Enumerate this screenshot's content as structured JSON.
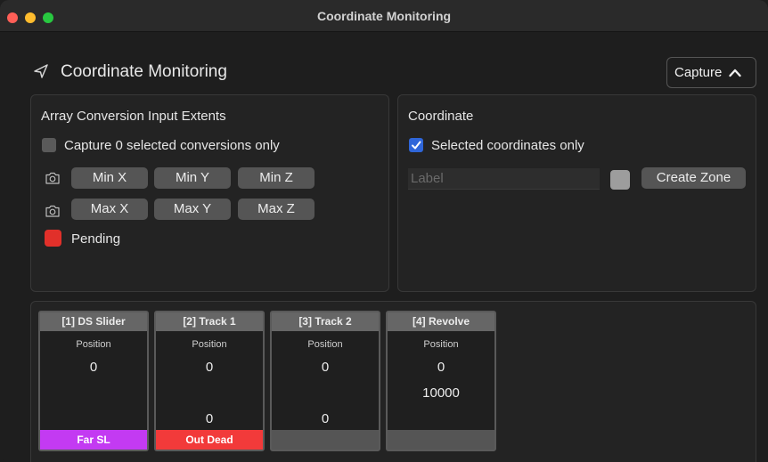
{
  "window": {
    "title": "Coordinate Monitoring"
  },
  "header": {
    "title": "Coordinate Monitoring",
    "icon": "navigation-arrow-icon",
    "capture_label": "Capture"
  },
  "extents": {
    "title": "Array Conversion Input Extents",
    "checkbox_label": "Capture 0 selected conversions only",
    "checkbox_checked": false,
    "min_buttons": [
      "Min X",
      "Min Y",
      "Min Z"
    ],
    "max_buttons": [
      "Max X",
      "Max Y",
      "Max Z"
    ],
    "status_label": "Pending",
    "status_color": "#e1302a"
  },
  "coordinate": {
    "title": "Coordinate",
    "checkbox_label": "Selected coordinates only",
    "checkbox_checked": true,
    "label_placeholder": "Label",
    "label_value": "",
    "create_zone_label": "Create Zone",
    "swatch_color": "#9d9d9d"
  },
  "cards": [
    {
      "name": "[1] DS Slider",
      "subtitle": "Position",
      "values": [
        "0",
        "",
        ""
      ],
      "footer": "Far SL",
      "footer_color": "#c33af2"
    },
    {
      "name": "[2] Track 1",
      "subtitle": "Position",
      "values": [
        "0",
        "",
        "0"
      ],
      "footer": "Out Dead",
      "footer_color": "#f23a3a"
    },
    {
      "name": "[3] Track 2",
      "subtitle": "Position",
      "values": [
        "0",
        "",
        "0"
      ],
      "footer": "",
      "footer_color": "#555555"
    },
    {
      "name": "[4] Revolve",
      "subtitle": "Position",
      "values": [
        "0",
        "10000",
        ""
      ],
      "footer": "",
      "footer_color": "#555555"
    }
  ]
}
